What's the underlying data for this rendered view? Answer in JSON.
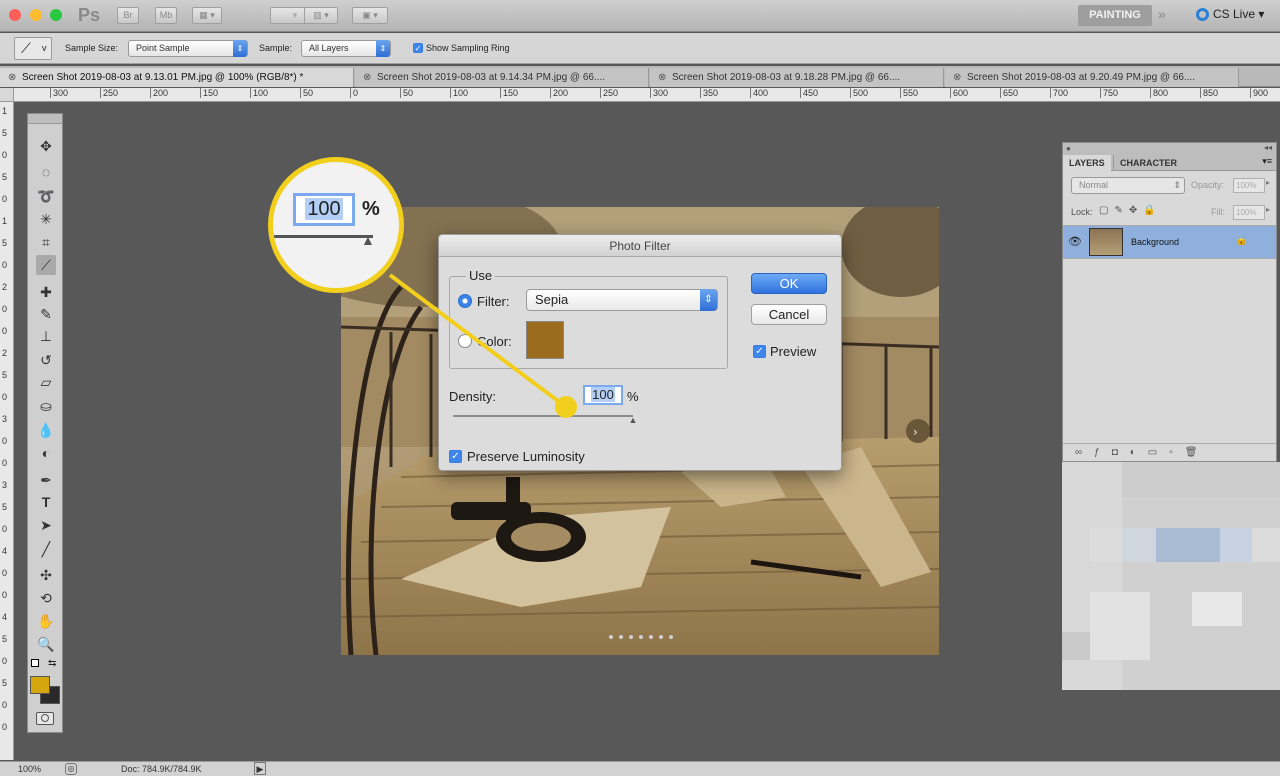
{
  "app": {
    "ps_logo": "Ps",
    "br_label": "Br",
    "mb_label": "Mb",
    "workspace": "PAINTING",
    "cs_live": "CS Live"
  },
  "options_bar": {
    "sample_size_label": "Sample Size:",
    "sample_size_value": "Point Sample",
    "sample_label": "Sample:",
    "sample_value": "All Layers",
    "show_ring_label": "Show Sampling Ring",
    "tool_preset": "v"
  },
  "tabs": [
    {
      "label": "Screen Shot 2019-08-03 at 9.13.01 PM.jpg @ 100% (RGB/8*) *",
      "active": true
    },
    {
      "label": "Screen Shot 2019-08-03 at 9.14.34 PM.jpg @ 66....",
      "active": false
    },
    {
      "label": "Screen Shot 2019-08-03 at 9.18.28 PM.jpg @ 66....",
      "active": false
    },
    {
      "label": "Screen Shot 2019-08-03 at 9.20.49 PM.jpg @ 66....",
      "active": false
    }
  ],
  "ruler": {
    "h_labels": [
      "300",
      "250",
      "200",
      "150",
      "100",
      "50",
      "0",
      "50",
      "100",
      "150",
      "200",
      "250",
      "300",
      "350",
      "400",
      "450",
      "500",
      "550",
      "600",
      "650",
      "700",
      "750",
      "800",
      "850",
      "900"
    ],
    "v_labels": [
      "1",
      "5",
      "0",
      "5",
      "0",
      "1",
      "5",
      "0",
      "2",
      "0",
      "0",
      "2",
      "5",
      "0",
      "3",
      "0",
      "0",
      "3",
      "5",
      "0",
      "4",
      "0",
      "0",
      "4",
      "5",
      "0",
      "5",
      "0",
      "0"
    ]
  },
  "dialog": {
    "title": "Photo Filter",
    "use_label": "Use",
    "filter_label": "Filter:",
    "filter_value": "Sepia",
    "color_label": "Color:",
    "color_swatch": "#9b6b1e",
    "density_label": "Density:",
    "density_value": "100",
    "density_unit": "%",
    "density_level": 1.0,
    "preserve_label": "Preserve Luminosity",
    "ok_label": "OK",
    "cancel_label": "Cancel",
    "preview_label": "Preview"
  },
  "callout": {
    "value": "100",
    "unit": "%",
    "color": "#f3cf1d"
  },
  "layers_panel": {
    "tab_layers": "LAYERS",
    "tab_character": "CHARACTER",
    "blend_mode": "Normal",
    "opacity_label": "Opacity:",
    "opacity_value": "100%",
    "lock_label": "Lock:",
    "fill_label": "Fill:",
    "fill_value": "100%",
    "layer_name": "Background"
  },
  "status": {
    "zoom": "100%",
    "doc": "Doc: 784.9K/784.9K"
  },
  "colors": {
    "foreground": "#d4a70e",
    "background": "#2a2a2a",
    "accent": "#3d84ea"
  }
}
